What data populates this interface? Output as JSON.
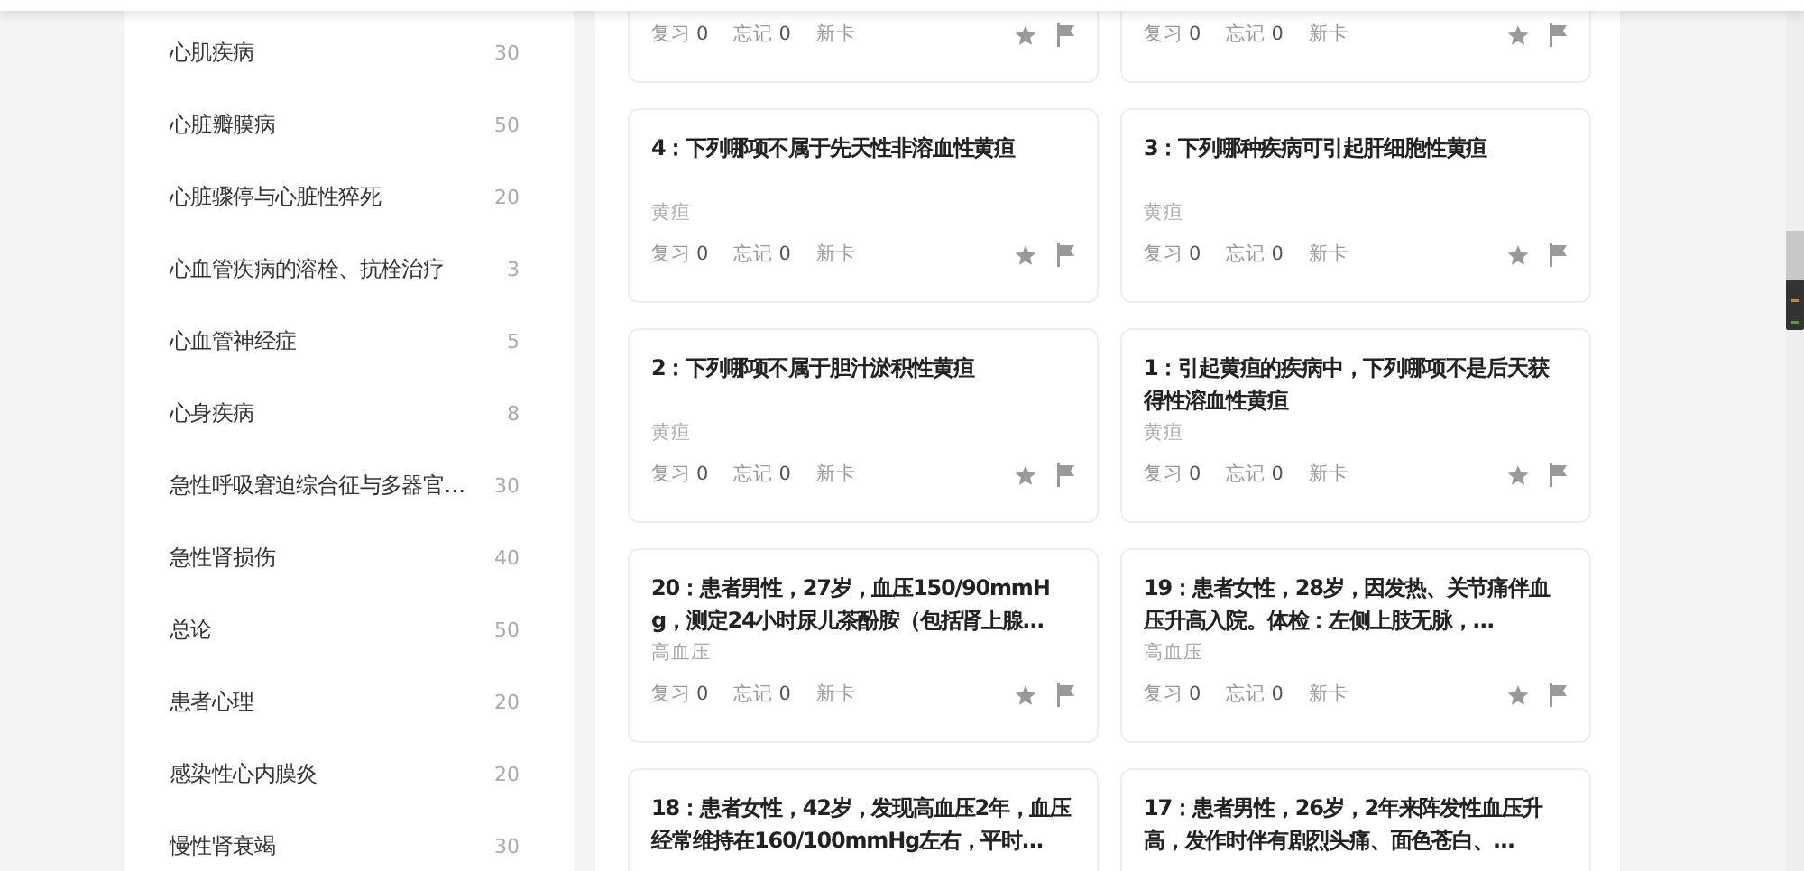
{
  "sidebar": {
    "items": [
      {
        "name": "心肌疾病",
        "count": "30"
      },
      {
        "name": "心脏瓣膜病",
        "count": "50"
      },
      {
        "name": "心脏骤停与心脏性猝死",
        "count": "20"
      },
      {
        "name": "心血管疾病的溶栓、抗栓治疗",
        "count": "3"
      },
      {
        "name": "心血管神经症",
        "count": "5"
      },
      {
        "name": "心身疾病",
        "count": "8"
      },
      {
        "name": "急性呼吸窘迫综合征与多器官…",
        "count": "30"
      },
      {
        "name": "急性肾损伤",
        "count": "40"
      },
      {
        "name": "总论",
        "count": "50"
      },
      {
        "name": "患者心理",
        "count": "20"
      },
      {
        "name": "感染性心内膜炎",
        "count": "20"
      },
      {
        "name": "慢性肾衰竭",
        "count": "30"
      }
    ]
  },
  "cards": [
    {
      "stats": [
        {
          "label": "复习",
          "count": "0"
        },
        {
          "label": "忘记",
          "count": "0"
        },
        {
          "label": "新卡"
        }
      ]
    },
    {
      "stats": [
        {
          "label": "复习",
          "count": "0"
        },
        {
          "label": "忘记",
          "count": "0"
        },
        {
          "label": "新卡"
        }
      ]
    },
    {
      "title": "4：下列哪项不属于先天性非溶血性黄疸",
      "tag": "黄疸",
      "stats": [
        {
          "label": "复习",
          "count": "0"
        },
        {
          "label": "忘记",
          "count": "0"
        },
        {
          "label": "新卡"
        }
      ]
    },
    {
      "title": "3：下列哪种疾病可引起肝细胞性黄疸",
      "tag": "黄疸",
      "stats": [
        {
          "label": "复习",
          "count": "0"
        },
        {
          "label": "忘记",
          "count": "0"
        },
        {
          "label": "新卡"
        }
      ]
    },
    {
      "title": "2：下列哪项不属于胆汁淤积性黄疸",
      "tag": "黄疸",
      "stats": [
        {
          "label": "复习",
          "count": "0"
        },
        {
          "label": "忘记",
          "count": "0"
        },
        {
          "label": "新卡"
        }
      ]
    },
    {
      "title": "1：引起黄疸的疾病中，下列哪项不是后天获得性溶血性黄疸",
      "tag": "黄疸",
      "stats": [
        {
          "label": "复习",
          "count": "0"
        },
        {
          "label": "忘记",
          "count": "0"
        },
        {
          "label": "新卡"
        }
      ]
    },
    {
      "title": "20：患者男性，27岁，血压150/90mmHg，测定24小时尿儿茶酚胺（包括肾上腺…",
      "tag": "高血压",
      "stats": [
        {
          "label": "复习",
          "count": "0"
        },
        {
          "label": "忘记",
          "count": "0"
        },
        {
          "label": "新卡"
        }
      ]
    },
    {
      "title": "19：患者女性，28岁，因发热、关节痛伴血压升高入院。体检：左侧上肢无脉，…",
      "tag": "高血压",
      "stats": [
        {
          "label": "复习",
          "count": "0"
        },
        {
          "label": "忘记",
          "count": "0"
        },
        {
          "label": "新卡"
        }
      ]
    },
    {
      "title": "18：患者女性，42岁，发现高血压2年，血压经常维持在160/100mmHg左右，平时…"
    },
    {
      "title": "17：患者男性，26岁，2年来阵发性血压升高，发作时伴有剧烈头痛、面色苍白、…"
    }
  ]
}
